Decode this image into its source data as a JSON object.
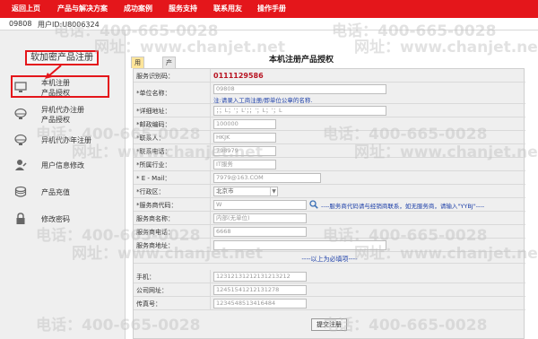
{
  "nav": {
    "items": [
      "返回上页",
      "产品与解决方案",
      "成功案例",
      "服务支持",
      "联系用友",
      "操作手册"
    ]
  },
  "info": {
    "code": "09808",
    "user_id": "用户ID:U8006324"
  },
  "sidebar": {
    "title": "软加密产品注册",
    "items": [
      {
        "icon": "monitor-icon",
        "lines": [
          "本机注册",
          "产品授权"
        ]
      },
      {
        "icon": "remote-monitor-icon",
        "lines": [
          "异机代办注册",
          "产品授权"
        ]
      },
      {
        "icon": "remote-annual-icon",
        "lines": [
          "异机代办年注册"
        ]
      },
      {
        "icon": "user-edit-icon",
        "lines": [
          "用户信息修改"
        ]
      },
      {
        "icon": "coins-icon",
        "lines": [
          "产品充值"
        ]
      },
      {
        "icon": "lock-icon",
        "lines": [
          "修改密码"
        ]
      }
    ]
  },
  "main": {
    "title": "本机注册产品授权",
    "tabs": [
      "用户信息",
      "产品信息"
    ]
  },
  "form": {
    "service_code_label": "服务识别码：",
    "service_code_value": "0111129586",
    "unit_label": "*单位名称：",
    "unit_value": "09808",
    "unit_hint": "注:请录入工商注册/即单位公章的名称.",
    "address_label": "*详细地址：",
    "address_value": "；；L；'；L'；；'；L；'；L",
    "postcode_label": "*邮政编码：",
    "postcode_value": "100000",
    "contact_label": "*联系人：",
    "contact_value": "HKJK",
    "phone_label": "*联系电话：",
    "phone_value": "798979",
    "industry_label": "*所属行业：",
    "industry_value": "IT服务",
    "email_label": "* E - Mail：",
    "email_value": "7979@163.COM",
    "region_label": "*行政区：",
    "region_value": "北京市",
    "provider_code_label": "*服务商代码：",
    "provider_code_value": "W",
    "provider_hint": "----服务商代码请与经销商联系，如无服务商，请输入\"YYBJ\"----",
    "provider_name_label": "服务商名称：",
    "provider_name_value": "内部(无单位)",
    "provider_phone_label": "服务商电话：",
    "provider_phone_value": "6668",
    "provider_address_label": "服务商地址：",
    "provider_address_value": "",
    "required_note": "----以上为必填项----",
    "mobile_label": "手机：",
    "mobile_value": "12312131212131213212",
    "website_label": "公司网址：",
    "website_value": "12451541212131278",
    "fax_label": "传真号：",
    "fax_value": "1234548513416484",
    "submit_label": "提交注册"
  },
  "watermarks": [
    "电话：400-665-0028",
    "网址：www.chanjet.net"
  ]
}
